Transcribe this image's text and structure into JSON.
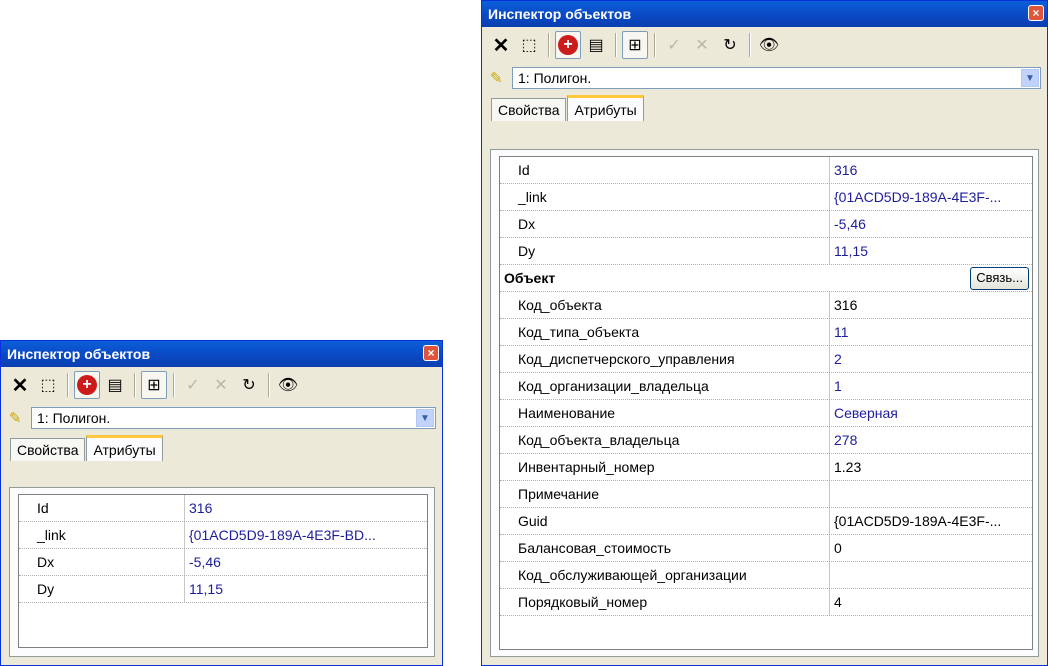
{
  "title": "Инспектор объектов",
  "close_glyph": "×",
  "toolbar": {
    "buttons": [
      {
        "icon": "delete-cross-icon",
        "glyph": "✕"
      },
      {
        "icon": "select-cursor-icon",
        "glyph": "⬚"
      },
      {
        "icon": "target-icon",
        "glyph": "⊕"
      },
      {
        "icon": "properties-card-icon",
        "glyph": "▤"
      },
      {
        "icon": "structure-tree-icon",
        "glyph": "⊞"
      },
      {
        "icon": "apply-check-icon",
        "glyph": "✓"
      },
      {
        "icon": "cancel-x-icon",
        "glyph": "✕"
      },
      {
        "icon": "refresh-icon",
        "glyph": "↻"
      },
      {
        "icon": "eye-icon",
        "glyph": "👁"
      }
    ]
  },
  "object_selector": {
    "value": "1: Полигон.",
    "icon": "pencil-icon"
  },
  "tabs": [
    "Свойства",
    "Атрибуты"
  ],
  "small_window": {
    "rows": [
      {
        "name": "Id",
        "value": "316"
      },
      {
        "name": "_link",
        "value": "{01ACD5D9-189A-4E3F-BD..."
      },
      {
        "name": "Dx",
        "value": "-5,46"
      },
      {
        "name": "Dy",
        "value": "11,15"
      }
    ]
  },
  "large_window": {
    "rows": [
      {
        "name": "Id",
        "value": "316"
      },
      {
        "name": "_link",
        "value": "{01ACD5D9-189A-4E3F-..."
      },
      {
        "name": "Dx",
        "value": "-5,46"
      },
      {
        "name": "Dy",
        "value": "11,15"
      }
    ],
    "section": {
      "title": "Объект",
      "button": "Связь..."
    },
    "section_rows": [
      {
        "name": "Код_объекта",
        "value": "316"
      },
      {
        "name": "Код_типа_объекта",
        "value": "11"
      },
      {
        "name": "Код_диспетчерского_управления",
        "value": "2"
      },
      {
        "name": "Код_организации_владельца",
        "value": "1"
      },
      {
        "name": "Наименование",
        "value": "Северная"
      },
      {
        "name": "Код_объекта_владельца",
        "value": "278"
      },
      {
        "name": "Инвентарный_номер",
        "value": "1.23"
      },
      {
        "name": "Примечание",
        "value": ""
      },
      {
        "name": "Guid",
        "value": "{01ACD5D9-189A-4E3F-..."
      },
      {
        "name": "Балансовая_стоимость",
        "value": "0"
      },
      {
        "name": "Код_обслуживающей_организации",
        "value": ""
      },
      {
        "name": "Порядковый_номер",
        "value": "4"
      }
    ]
  }
}
